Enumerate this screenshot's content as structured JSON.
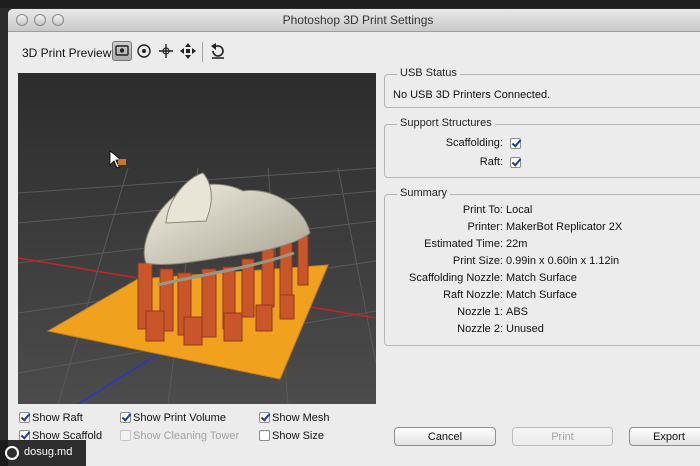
{
  "window": {
    "title": "Photoshop 3D Print Settings"
  },
  "toolbar": {
    "label": "3D Print Preview",
    "buttons": [
      {
        "icon": "view-preview-icon",
        "active": true
      },
      {
        "icon": "orbit-icon",
        "active": false
      },
      {
        "icon": "pan-icon",
        "active": false
      },
      {
        "icon": "move-icon",
        "active": false
      },
      {
        "icon": "reset-view-icon",
        "active": false
      }
    ]
  },
  "usb_status": {
    "legend": "USB Status",
    "text": "No USB 3D Printers Connected."
  },
  "support": {
    "legend": "Support Structures",
    "scaffolding_label": "Scaffolding:",
    "scaffolding_checked": true,
    "raft_label": "Raft:",
    "raft_checked": true
  },
  "summary": {
    "legend": "Summary",
    "rows": [
      {
        "key": "Print To:",
        "value": "Local"
      },
      {
        "key": "Printer:",
        "value": "MakerBot Replicator 2X"
      },
      {
        "key": "Estimated Time:",
        "value": "22m"
      },
      {
        "key": "Print Size:",
        "value": "0.99in x 0.60in x 1.12in"
      },
      {
        "key": "Scaffolding Nozzle:",
        "value": "Match Surface"
      },
      {
        "key": "Raft Nozzle:",
        "value": "Match Surface"
      },
      {
        "key": "Nozzle 1:",
        "value": "ABS"
      },
      {
        "key": "Nozzle 2:",
        "value": "Unused"
      }
    ]
  },
  "options": {
    "show_raft": {
      "label": "Show Raft",
      "checked": true
    },
    "show_scaffold": {
      "label": "Show Scaffold",
      "checked": true
    },
    "show_print_volume": {
      "label": "Show Print Volume",
      "checked": true
    },
    "show_cleaning_tower": {
      "label": "Show Cleaning Tower",
      "checked": false,
      "disabled": true
    },
    "show_mesh": {
      "label": "Show Mesh",
      "checked": true
    },
    "show_size": {
      "label": "Show Size",
      "checked": false
    }
  },
  "buttons": {
    "cancel": "Cancel",
    "print": "Print",
    "export": "Export"
  },
  "watermark": {
    "text": "dosug.md"
  },
  "colors": {
    "raft": "#f0a21f",
    "scaffold": "#c9562a",
    "model": "#d9d6c8",
    "grid_red": "#c0262a",
    "grid_blue": "#2a35c9"
  }
}
